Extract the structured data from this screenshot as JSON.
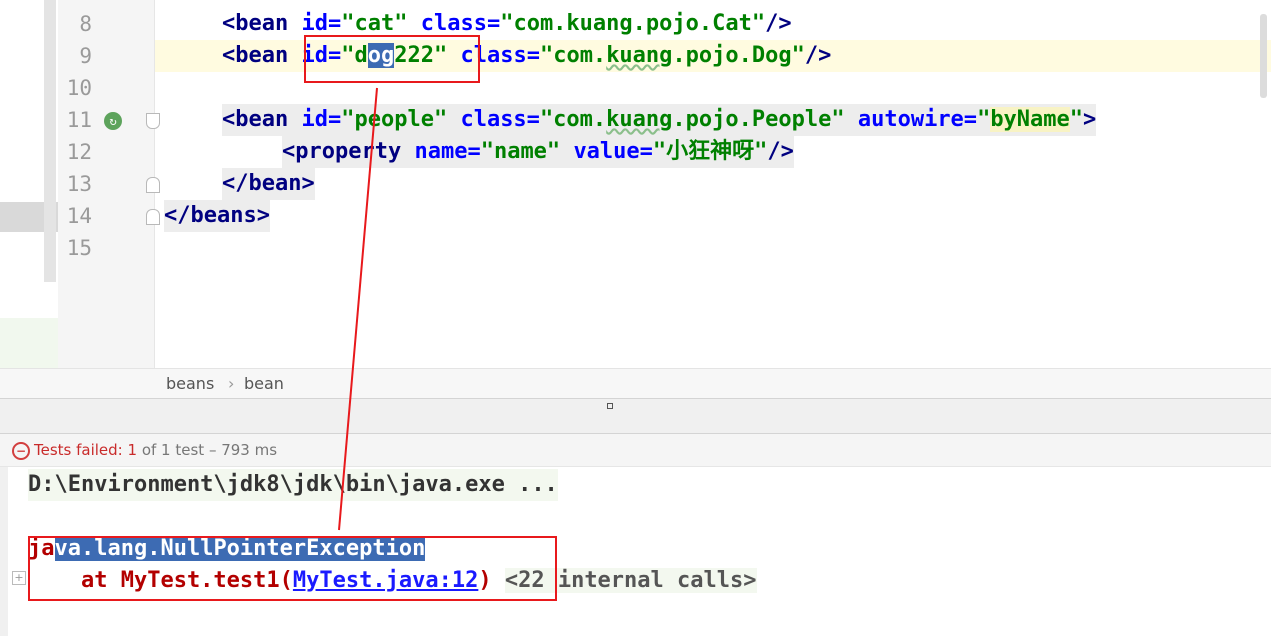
{
  "editor": {
    "line_numbers": [
      "8",
      "9",
      "10",
      "11",
      "12",
      "13",
      "14",
      "15"
    ],
    "lines": {
      "l8": {
        "tag_open": "<bean",
        "id_attr": "id=",
        "id_val": "\"cat\"",
        "class_attr": "class=",
        "class_val": "\"com.kuang.pojo.Cat\"",
        "close": "/>"
      },
      "l9": {
        "tag_open": "<bean",
        "id_attr": "id=",
        "id_val_pre": "\"d",
        "id_val_sel": "og",
        "id_val_post": "222\"",
        "class_attr": "class=",
        "class_val_pre": "\"com.",
        "class_val_squig": "kuang",
        "class_val_mid": ".po",
        "class_val_post": "jo.Dog\"",
        "close": "/>"
      },
      "l11": {
        "tag_open": "<bean",
        "id_attr": "id=",
        "id_val": "\"people\"",
        "class_attr": "class=",
        "class_val_pre": "\"com.",
        "class_val_squig": "kuang",
        "class_val_post": ".pojo.People\"",
        "autowire_attr": "autowire=",
        "autowire_q1": "\"",
        "autowire_val": "byName",
        "autowire_q2": "\"",
        "close": ">"
      },
      "l12": {
        "tag_open": "<property",
        "name_attr": "name=",
        "name_val": "\"name\"",
        "value_attr": "value=",
        "value_val": "\"小狂神呀\"",
        "close": "/>"
      },
      "l13": {
        "text": "</bean>"
      },
      "l14": {
        "text": "</beans>"
      }
    },
    "breadcrumb": {
      "first": "beans",
      "sep": "›",
      "second": "bean"
    }
  },
  "run_panel": {
    "status": {
      "label": "Tests failed: ",
      "failed": "1",
      "suffix": " of 1 test – 793 ms"
    },
    "console": {
      "cmd": "D:\\Environment\\jdk8\\jdk\\bin\\java.exe ...",
      "exception_pre": "ja",
      "exception_sel": "va.lang.NullPointerException",
      "at_text": "    at MyTest.test1(",
      "at_link": "MyTest.java:12",
      "at_close": ")",
      "internal": "<22 internal calls>"
    }
  },
  "colors": {
    "annotation": "#e8191c",
    "selection": "#3d6bb3",
    "tag": "#000080",
    "attribute": "#0000ff",
    "string": "#008000"
  }
}
